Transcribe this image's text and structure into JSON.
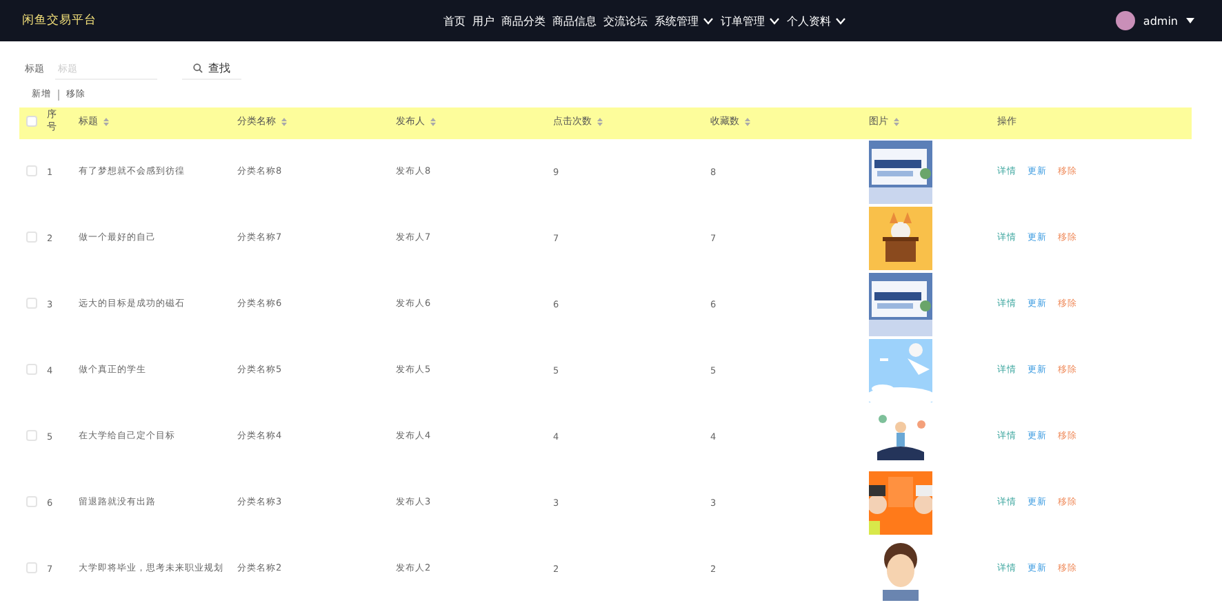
{
  "brand": "闲鱼交易平台",
  "nav": [
    {
      "label": "首页",
      "has_menu": false
    },
    {
      "label": "用户",
      "has_menu": false
    },
    {
      "label": "商品分类",
      "has_menu": false
    },
    {
      "label": "商品信息",
      "has_menu": false
    },
    {
      "label": "交流论坛",
      "has_menu": false
    },
    {
      "label": "系统管理",
      "has_menu": true
    },
    {
      "label": "订单管理",
      "has_menu": true
    },
    {
      "label": "个人资料",
      "has_menu": true
    }
  ],
  "user": {
    "name": "admin"
  },
  "search": {
    "label": "标题",
    "placeholder": "标题",
    "button": "查找"
  },
  "actions": [
    "新增",
    "移除"
  ],
  "table": {
    "select_all": {
      "checked": false
    },
    "columns": [
      {
        "label": "序号",
        "sortable": false
      },
      {
        "label": "标题",
        "sortable": true
      },
      {
        "label": "分类名称",
        "sortable": true
      },
      {
        "label": "发布人",
        "sortable": true
      },
      {
        "label": "点击次数",
        "sortable": true
      },
      {
        "label": "收藏数",
        "sortable": true
      },
      {
        "label": "图片",
        "sortable": true
      },
      {
        "label": "操作",
        "sortable": false
      }
    ],
    "rows": [
      {
        "checked": false,
        "index": "1",
        "title": "有了梦想就不会感到彷徨",
        "category": "分类名称8",
        "publisher": "发布人8",
        "clicks": "9",
        "favorites": "8",
        "actions": [
          {
            "label": "详情",
            "kind": "view"
          },
          {
            "label": "更新",
            "kind": "edit"
          },
          {
            "label": "移除",
            "kind": "delete"
          }
        ]
      },
      {
        "checked": false,
        "index": "2",
        "title": "做一个最好的自己",
        "category": "分类名称7",
        "publisher": "发布人7",
        "clicks": "7",
        "favorites": "7",
        "actions": [
          {
            "label": "详情",
            "kind": "view"
          },
          {
            "label": "更新",
            "kind": "edit"
          },
          {
            "label": "移除",
            "kind": "delete"
          }
        ]
      },
      {
        "checked": false,
        "index": "3",
        "title": "远大的目标是成功的磁石",
        "category": "分类名称6",
        "publisher": "发布人6",
        "clicks": "6",
        "favorites": "6",
        "actions": [
          {
            "label": "详情",
            "kind": "view"
          },
          {
            "label": "更新",
            "kind": "edit"
          },
          {
            "label": "移除",
            "kind": "delete"
          }
        ]
      },
      {
        "checked": false,
        "index": "4",
        "title": "做个真正的学生",
        "category": "分类名称5",
        "publisher": "发布人5",
        "clicks": "5",
        "favorites": "5",
        "actions": [
          {
            "label": "详情",
            "kind": "view"
          },
          {
            "label": "更新",
            "kind": "edit"
          },
          {
            "label": "移除",
            "kind": "delete"
          }
        ]
      },
      {
        "checked": false,
        "index": "5",
        "title": "在大学给自己定个目标",
        "category": "分类名称4",
        "publisher": "发布人4",
        "clicks": "4",
        "favorites": "4",
        "actions": [
          {
            "label": "详情",
            "kind": "view"
          },
          {
            "label": "更新",
            "kind": "edit"
          },
          {
            "label": "移除",
            "kind": "delete"
          }
        ]
      },
      {
        "checked": false,
        "index": "6",
        "title": "留退路就没有出路",
        "category": "分类名称3",
        "publisher": "发布人3",
        "clicks": "3",
        "favorites": "3",
        "actions": [
          {
            "label": "详情",
            "kind": "view"
          },
          {
            "label": "更新",
            "kind": "edit"
          },
          {
            "label": "移除",
            "kind": "delete"
          }
        ]
      },
      {
        "checked": false,
        "index": "7",
        "title": "大学即将毕业，思考未来职业规划",
        "category": "分类名称2",
        "publisher": "发布人2",
        "clicks": "2",
        "favorites": "2",
        "actions": [
          {
            "label": "详情",
            "kind": "view"
          },
          {
            "label": "更新",
            "kind": "edit"
          },
          {
            "label": "移除",
            "kind": "delete"
          }
        ]
      }
    ]
  }
}
